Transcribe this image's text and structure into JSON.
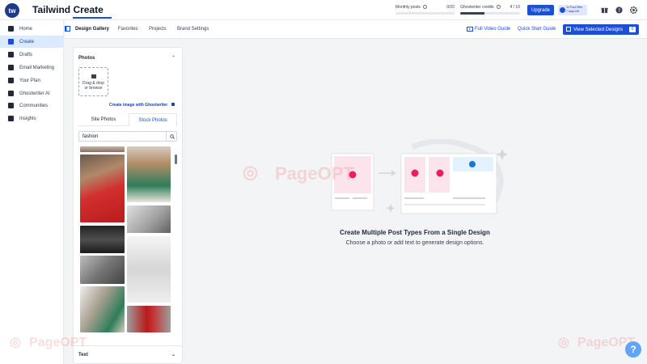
{
  "app": {
    "logo_text": "tw",
    "title": "Tailwind Create"
  },
  "usage": {
    "monthly_label": "Monthly posts",
    "monthly_value": "0/20",
    "monthly_progress": 0.0,
    "ghost_label": "Ghostwriter credits",
    "ghost_value": "4 / 10",
    "ghost_progress": 0.4
  },
  "header": {
    "upgrade_label": "Upgrade",
    "offer_lines": [
      "1x Post Offer",
      "7 days left"
    ],
    "icons": [
      "gift-icon",
      "help-icon",
      "settings-icon"
    ]
  },
  "sidebar": {
    "items": [
      {
        "label": "Home",
        "icon": "home-icon"
      },
      {
        "label": "Create",
        "icon": "pencil-icon",
        "active": true
      },
      {
        "label": "Drafts",
        "icon": "drafts-icon"
      },
      {
        "label": "Email Marketing",
        "icon": "email-icon"
      },
      {
        "label": "Your Plan",
        "icon": "calendar-icon"
      },
      {
        "label": "Ghostwriter AI",
        "icon": "sparkle-icon"
      },
      {
        "label": "Communities",
        "icon": "people-icon"
      },
      {
        "label": "Insights",
        "icon": "chart-icon"
      }
    ]
  },
  "tabs": {
    "items": [
      "Design Gallery",
      "Favorites",
      "Projects",
      "Brand Settings"
    ],
    "active": "Design Gallery",
    "video_guide": "Full Video Guide",
    "quick_start": "Quick Start Guide",
    "view_selected": "View Selected Designs",
    "selected_count": "0"
  },
  "panel": {
    "photos_heading": "Photos",
    "drop_line1": "Drag & drop",
    "drop_line2": "or browse",
    "ghostwriter_link": "Create image with Ghostwriter",
    "site_photos": "Site Photos",
    "stock_photos": "Stock Photos",
    "search_value": "fashion",
    "text_heading": "Text"
  },
  "main": {
    "title": "Create Multiple Post Types From a Single Design",
    "subtitle": "Choose a photo or add text to generate design options."
  },
  "watermark": "PageOPT",
  "help_label": "?"
}
